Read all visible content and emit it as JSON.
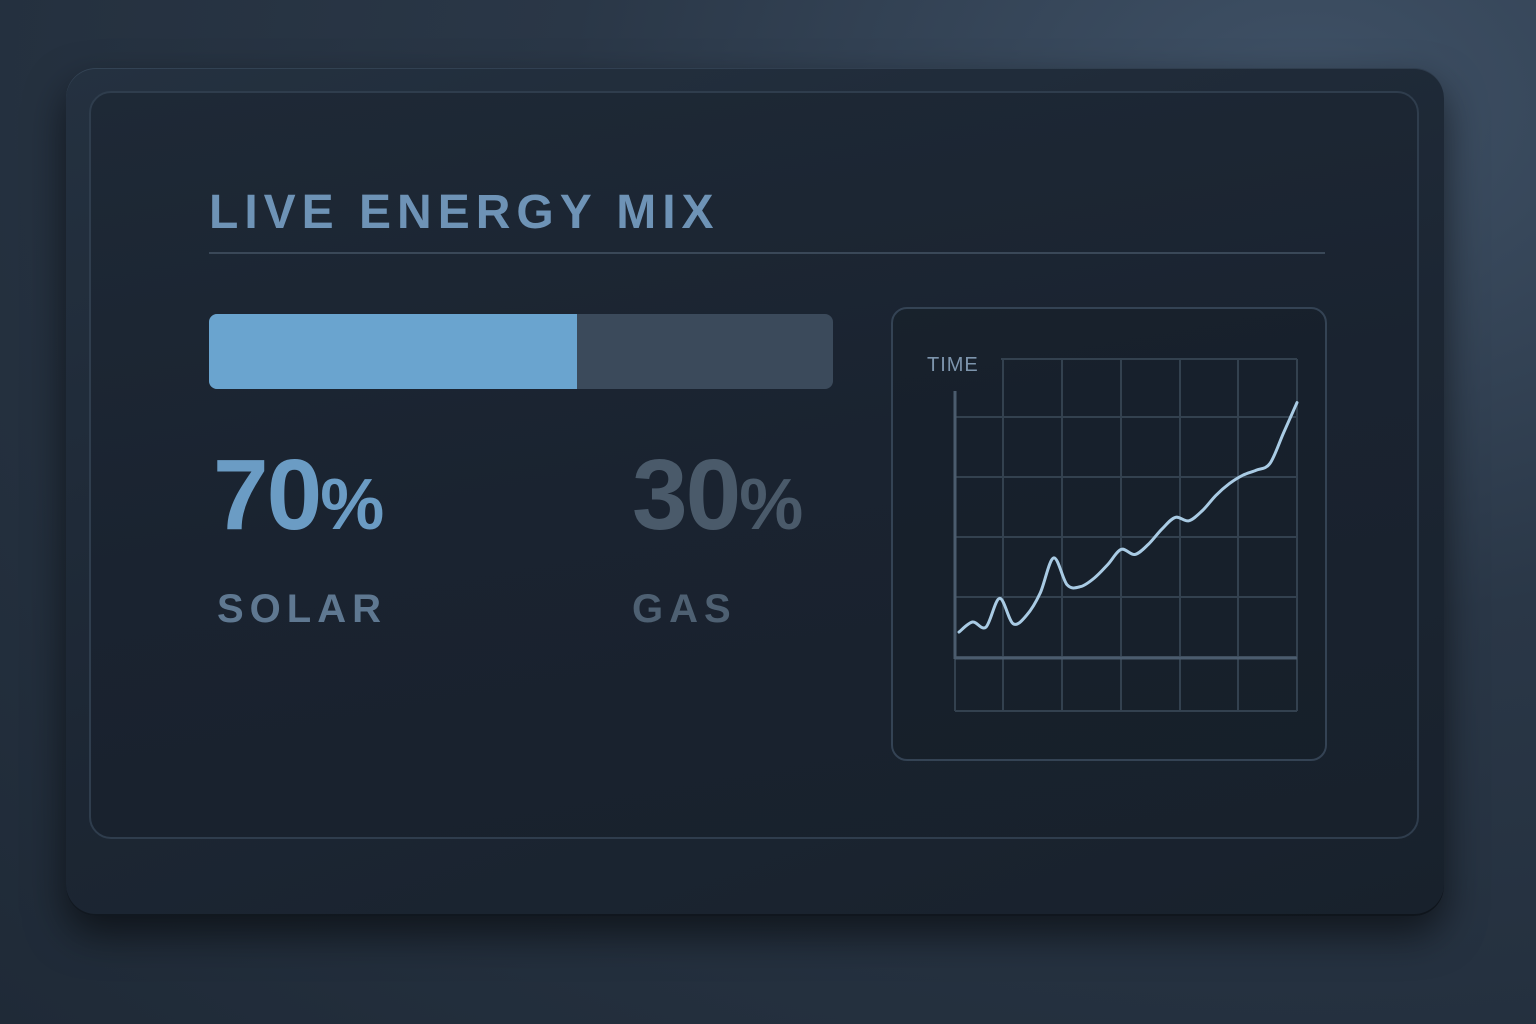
{
  "panel": {
    "title": "LIVE ENERGY MIX"
  },
  "mix": {
    "solar_fraction": 0.59,
    "colors": {
      "solar": "#6aa4cf",
      "gas": "#3b4a5b"
    }
  },
  "stats": {
    "solar": {
      "value": "70",
      "unit": "%",
      "label": "SOLAR"
    },
    "gas": {
      "value": "30",
      "unit": "%",
      "label": "GAS"
    }
  },
  "chart_data": {
    "type": "line",
    "title": "",
    "xlabel": "",
    "ylabel": "TIME",
    "grid": true,
    "line_color": "#a9cbe4",
    "x": [
      0,
      1,
      2,
      3,
      4,
      5,
      6,
      7,
      8,
      9,
      10,
      11,
      12,
      13,
      14,
      15,
      16,
      17,
      18,
      19,
      20,
      21,
      22,
      23,
      24,
      25
    ],
    "values": [
      1.0,
      1.6,
      1.3,
      3.0,
      1.5,
      2.0,
      3.3,
      5.4,
      3.8,
      3.7,
      4.2,
      5.0,
      5.9,
      5.6,
      6.2,
      7.1,
      7.8,
      7.6,
      8.2,
      9.1,
      9.8,
      10.3,
      10.6,
      11.0,
      12.8,
      14.6
    ],
    "ylim": [
      0,
      16
    ]
  }
}
